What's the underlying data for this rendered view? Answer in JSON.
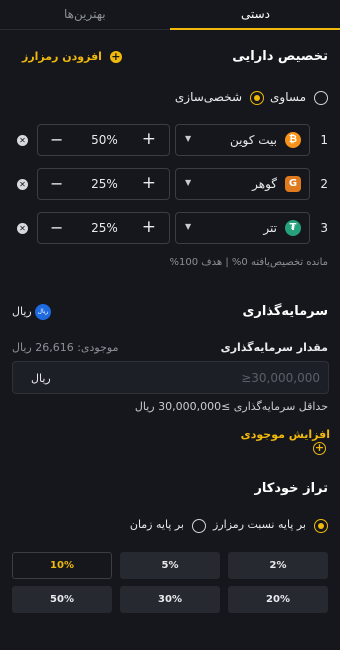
{
  "tabs": {
    "manual": "دستی",
    "best": "بهترین‌ها"
  },
  "allocation": {
    "title": "تخصیص دارایی",
    "add_coin": "افزودن رمزارز",
    "mode_equal": "مساوی",
    "mode_custom": "شخصی‌سازی",
    "selected_mode": "custom",
    "rows": [
      {
        "num": "1",
        "coin": "بیت کوین",
        "icon": "bitcoin-icon",
        "icon_glyph": "₿",
        "icon_color": "#f7931a",
        "percent": "50%"
      },
      {
        "num": "2",
        "coin": "گوهر",
        "icon": "gohar-icon",
        "icon_glyph": "G",
        "icon_color": "#e07a1f",
        "percent": "25%"
      },
      {
        "num": "3",
        "coin": "تتر",
        "icon": "tether-icon",
        "icon_glyph": "₮",
        "icon_color": "#26a17b",
        "percent": "25%"
      }
    ],
    "summary": "مانده تخصیص‌یافته 0% | هدف 100%"
  },
  "investment": {
    "title": "سرمایه‌گذاری",
    "currency": "ریال",
    "currency_badge": "ریال",
    "amount_label": "مقدار سرمایه‌گذاری",
    "balance": "موجودی: 26,616 ریال",
    "placeholder": "≥30,000,000",
    "input_currency": "ریال",
    "min_note": "حداقل سرمایه‌گذاری ≥30,000,000 ریال",
    "increase_balance": "افزایش موجودی"
  },
  "rebalance": {
    "title": "تراز خودکار",
    "option_ratio": "بر پایه نسبت رمزارز",
    "option_time": "بر پایه زمان",
    "selected": "ratio",
    "options": [
      "2%",
      "5%",
      "10%",
      "20%",
      "30%",
      "50%"
    ],
    "active_option": "10%"
  },
  "colors": {
    "accent": "#f0b90b",
    "background": "#15171c",
    "input_bg": "#1c1f25",
    "button_bg": "#262930"
  }
}
